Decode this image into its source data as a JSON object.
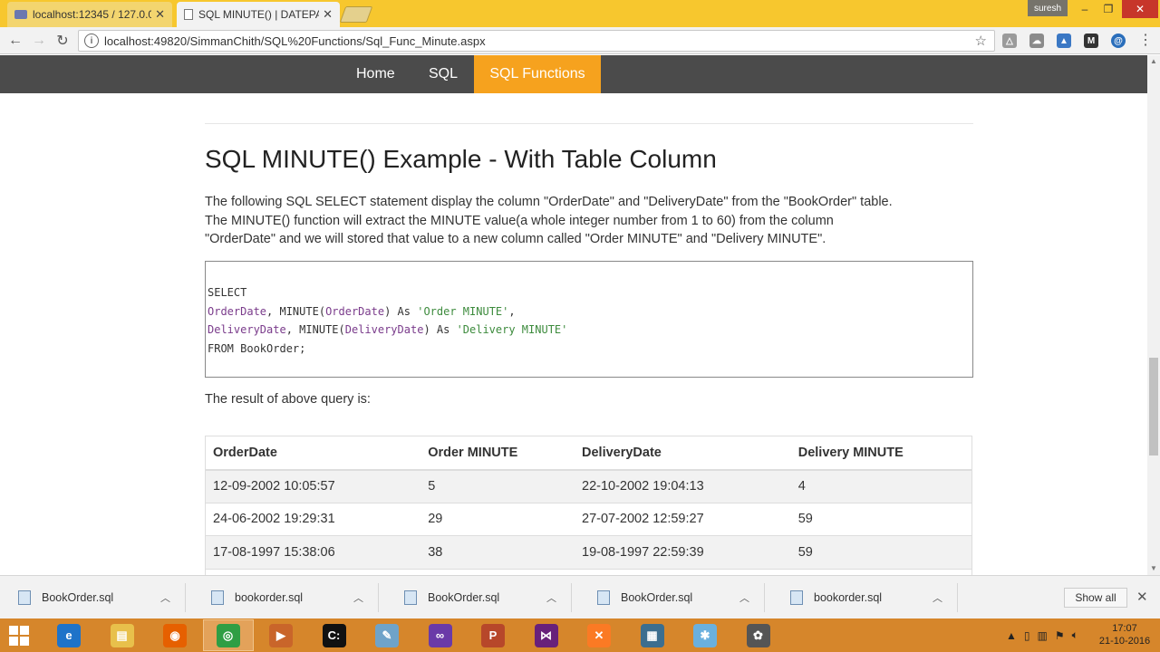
{
  "browser": {
    "tabs": [
      {
        "title": "localhost:12345 / 127.0.0",
        "favicon": "phpmyadmin-icon"
      },
      {
        "title": "SQL MINUTE() | DATEPAR",
        "favicon": "page-icon"
      }
    ],
    "profile_name": "suresh",
    "window_controls": {
      "minimize": "–",
      "maximize": "❐",
      "close": "✕"
    },
    "url": "localhost:49820/SimmanChith/SQL%20Functions/Sql_Func_Minute.aspx"
  },
  "site_nav": {
    "items": [
      {
        "label": "Home"
      },
      {
        "label": "SQL"
      },
      {
        "label": "SQL Functions",
        "active": true
      }
    ],
    "bar_color": "#4b4b4b",
    "active_color": "#f6a21e"
  },
  "article": {
    "title": "SQL MINUTE() Example - With Table Column",
    "description_lines": [
      "The following SQL SELECT statement display the column \"OrderDate\" and \"DeliveryDate\" from the \"BookOrder\" table.",
      "The MINUTE() function will extract the MINUTE value(a whole integer number from 1 to 60) from the column",
      "\"OrderDate\" and we will stored that value to a new column called \"Order MINUTE\" and \"Delivery MINUTE\"."
    ],
    "code": {
      "line1": "SELECT",
      "line2_col": "OrderDate",
      "line2_mid": ", MINUTE(",
      "line2_arg": "OrderDate",
      "line2_as": ") As ",
      "line2_str": "'Order MINUTE'",
      "line2_end": ",",
      "line3_col": "DeliveryDate",
      "line3_mid": ", MINUTE(",
      "line3_arg": "DeliveryDate",
      "line3_as": ") As ",
      "line3_str": "'Delivery MINUTE'",
      "line4": "FROM BookOrder;"
    },
    "result_label": "The result of above query is:",
    "table": {
      "headers": [
        "OrderDate",
        "Order MINUTE",
        "DeliveryDate",
        "Delivery MINUTE"
      ],
      "rows": [
        [
          "12-09-2002 10:05:57",
          "5",
          "22-10-2002 19:04:13",
          "4"
        ],
        [
          "24-06-2002 19:29:31",
          "29",
          "27-07-2002 12:59:27",
          "59"
        ],
        [
          "17-08-1997 15:38:06",
          "38",
          "19-08-1997 22:59:39",
          "59"
        ]
      ]
    }
  },
  "downloads": {
    "items": [
      "BookOrder.sql",
      "bookorder.sql",
      "BookOrder.sql",
      "BookOrder.sql",
      "bookorder.sql"
    ],
    "show_all": "Show all"
  },
  "taskbar": {
    "apps": [
      {
        "icon": "internet-explorer-icon",
        "color": "#1e73c9",
        "glyph": "e"
      },
      {
        "icon": "file-explorer-icon",
        "color": "#e8c04b",
        "glyph": "▤"
      },
      {
        "icon": "firefox-icon",
        "color": "#e66000",
        "glyph": "◉"
      },
      {
        "icon": "chrome-icon",
        "color": "#2f9e44",
        "glyph": "◎",
        "active": true
      },
      {
        "icon": "media-player-icon",
        "color": "#c9652a",
        "glyph": "▶"
      },
      {
        "icon": "command-prompt-icon",
        "color": "#111111",
        "glyph": "C:"
      },
      {
        "icon": "notepad-icon",
        "color": "#6fa3c9",
        "glyph": "✎"
      },
      {
        "icon": "visual-studio-infinity-icon",
        "color": "#6a3aa8",
        "glyph": "∞"
      },
      {
        "icon": "powerpoint-icon",
        "color": "#b7472a",
        "glyph": "P"
      },
      {
        "icon": "visual-studio-icon",
        "color": "#68217a",
        "glyph": "⋈"
      },
      {
        "icon": "xampp-icon",
        "color": "#fb7a24",
        "glyph": "✕"
      },
      {
        "icon": "sql-server-icon",
        "color": "#3c6e8f",
        "glyph": "▦"
      },
      {
        "icon": "paint-icon",
        "color": "#6ab0de",
        "glyph": "✱"
      },
      {
        "icon": "film-reel-icon",
        "color": "#555555",
        "glyph": "✿"
      }
    ],
    "time": "17:07",
    "date": "21-10-2016",
    "color": "#d6862b"
  }
}
